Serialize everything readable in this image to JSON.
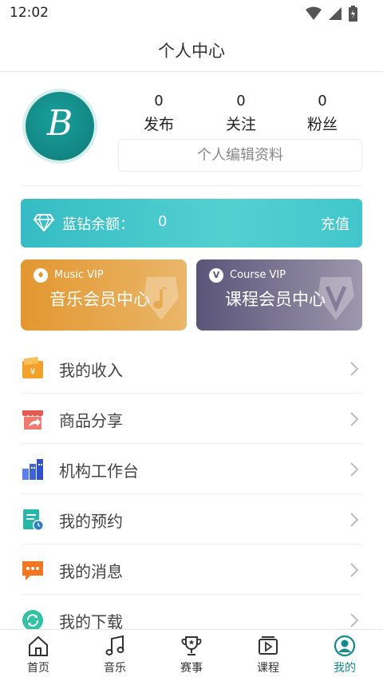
{
  "status_bar": {
    "time": "12:02"
  },
  "header": {
    "title": "个人中心"
  },
  "profile": {
    "avatar_letter": "B",
    "stats": [
      {
        "value": "0",
        "label": "发布"
      },
      {
        "value": "0",
        "label": "关注"
      },
      {
        "value": "0",
        "label": "粉丝"
      }
    ],
    "edit_label": "个人编辑资料"
  },
  "balance": {
    "label": "蓝钻余额：",
    "value": "0",
    "action": "充值"
  },
  "vip": {
    "music": {
      "small": "Music VIP",
      "title": "音乐会员中心",
      "badge": "♦"
    },
    "course": {
      "small": "Course VIP",
      "title": "课程会员中心",
      "badge": "V"
    }
  },
  "menu": [
    {
      "label": "我的收入",
      "icon": "wallet-icon"
    },
    {
      "label": "商品分享",
      "icon": "shop-share-icon"
    },
    {
      "label": "机构工作台",
      "icon": "buildings-icon"
    },
    {
      "label": "我的预约",
      "icon": "appointment-icon"
    },
    {
      "label": "我的消息",
      "icon": "message-icon"
    },
    {
      "label": "我的下载",
      "icon": "download-icon"
    }
  ],
  "nav": [
    {
      "label": "首页",
      "icon": "home-icon"
    },
    {
      "label": "音乐",
      "icon": "music-note-icon"
    },
    {
      "label": "赛事",
      "icon": "trophy-icon"
    },
    {
      "label": "课程",
      "icon": "course-video-icon"
    },
    {
      "label": "我的",
      "icon": "profile-icon",
      "active": true
    }
  ],
  "colors": {
    "accent": "#138c89",
    "balance": "#42c6cc",
    "music_vip": "#e3972f",
    "course_vip": "#5a5479"
  }
}
